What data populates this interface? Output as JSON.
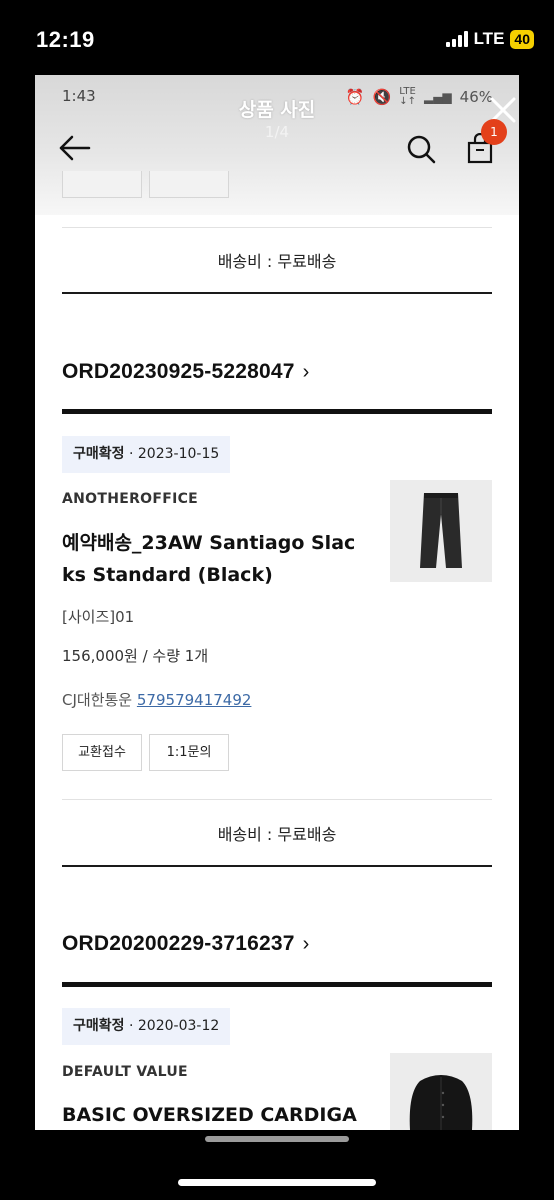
{
  "outer_status": {
    "time": "12:19",
    "network": "LTE",
    "battery": "40"
  },
  "inner_status": {
    "time": "1:43",
    "battery": "46%"
  },
  "viewer": {
    "title": "상품 사진",
    "counter": "1/4"
  },
  "cart": {
    "badge": "1"
  },
  "sections": [
    {
      "shipping": "배송비 : 무료배송"
    },
    {
      "order_no": "ORD20230925-5228047",
      "status": "구매확정",
      "date": "2023-10-15",
      "brand": "ANOTHEROFFICE",
      "name_line1": "예약배송_23AW Santiago Slac",
      "name_line2": "ks Standard (Black)",
      "option": "[사이즈]01",
      "price": "156,000원 / 수량 1개",
      "courier": "CJ대한통운",
      "tracking": "579579417492",
      "exchange_label": "교환접수",
      "inquiry_label": "1:1문의",
      "shipping": "배송비 : 무료배송"
    },
    {
      "order_no": "ORD20200229-3716237",
      "status": "구매확정",
      "date": "2020-03-12",
      "brand": "DEFAULT VALUE",
      "name_line1": "BASIC OVERSIZED CARDIGA"
    }
  ],
  "colors": {
    "accent_badge": "#e3401b",
    "link": "#3d6aa6",
    "status_bg": "#eef2fb"
  },
  "icons": [
    "back-arrow-icon",
    "search-icon",
    "shopping-bag-icon",
    "close-icon"
  ]
}
